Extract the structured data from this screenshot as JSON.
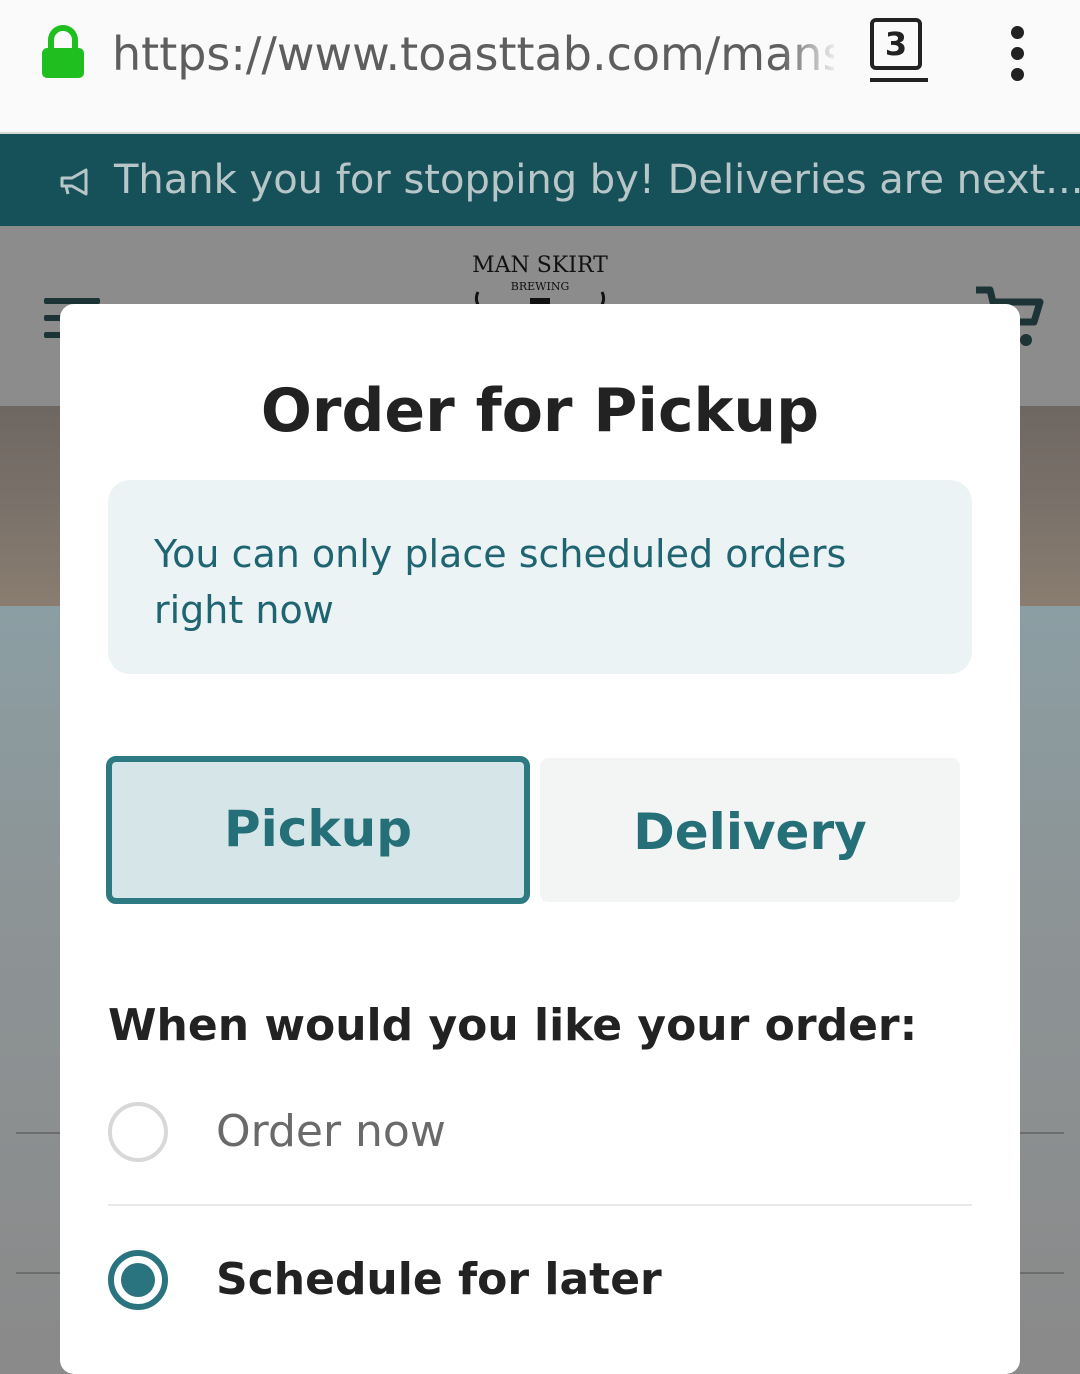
{
  "browser": {
    "url": "https://www.toasttab.com/mansk",
    "tab_count": "3",
    "icons": [
      "lock-icon",
      "tabs-icon",
      "overflow-menu-icon"
    ]
  },
  "banner": {
    "text": "Thank you for stopping by! Deliveries are next...",
    "icon": "megaphone-icon"
  },
  "header": {
    "logo": {
      "name": "MAN SKIRT",
      "sub": "BREWING"
    },
    "icons": [
      "hamburger-menu-icon",
      "cart-icon"
    ]
  },
  "modal": {
    "title": "Order for Pickup",
    "notice": "You can only place scheduled orders right now",
    "mode_tabs": [
      {
        "label": "Pickup",
        "selected": true
      },
      {
        "label": "Delivery",
        "selected": false
      }
    ],
    "when_label": "When would you like your order:",
    "options": [
      {
        "label": "Order now",
        "selected": false
      },
      {
        "label": "Schedule for later",
        "selected": true
      }
    ]
  },
  "colors": {
    "accent": "#2a7480",
    "banner": "#16515a",
    "lock": "#1fbf1f"
  }
}
